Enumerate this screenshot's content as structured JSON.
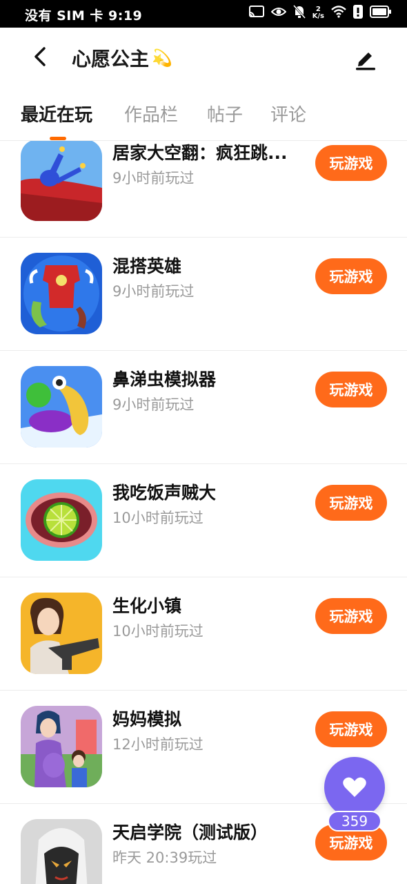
{
  "status_bar": {
    "carrier_time": "没有 SIM 卡 9:19",
    "net_speed_top": "2",
    "net_speed_unit": "K/s"
  },
  "header": {
    "title": "心愿公主",
    "title_emoji": "💫"
  },
  "tabs": [
    {
      "label": "最近在玩",
      "active": true
    },
    {
      "label": "作品栏",
      "active": false
    },
    {
      "label": "帖子",
      "active": false
    },
    {
      "label": "评论",
      "active": false
    }
  ],
  "games": [
    {
      "name": "居家大空翻：疯狂跳...",
      "played": "9小时前玩过",
      "button": "玩游戏",
      "icon": "flip-game-icon"
    },
    {
      "name": "混搭英雄",
      "played": "9小时前玩过",
      "button": "玩游戏",
      "icon": "hero-mix-icon"
    },
    {
      "name": "鼻涕虫模拟器",
      "played": "9小时前玩过",
      "button": "玩游戏",
      "icon": "slug-sim-icon"
    },
    {
      "name": "我吃饭声贼大",
      "played": "10小时前玩过",
      "button": "玩游戏",
      "icon": "eating-asmr-icon"
    },
    {
      "name": "生化小镇",
      "played": "10小时前玩过",
      "button": "玩游戏",
      "icon": "bio-town-icon"
    },
    {
      "name": "妈妈模拟",
      "played": "12小时前玩过",
      "button": "玩游戏",
      "icon": "mom-sim-icon"
    },
    {
      "name": "天启学院（测试版）",
      "played": "昨天 20:39玩过",
      "button": "玩游戏",
      "icon": "academy-icon"
    }
  ],
  "favorite": {
    "count": "359"
  },
  "colors": {
    "accent": "#ff6a1a",
    "favorite": "#7b67f0"
  }
}
